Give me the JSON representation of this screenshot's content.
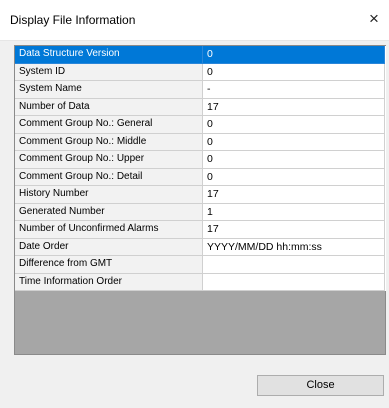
{
  "window": {
    "title": "Display File Information",
    "close_glyph": "×"
  },
  "grid": {
    "rows": [
      {
        "label": "Data Structure Version",
        "value": "0"
      },
      {
        "label": "System ID",
        "value": "0"
      },
      {
        "label": "System Name",
        "value": "-"
      },
      {
        "label": "Number of Data",
        "value": "17"
      },
      {
        "label": "Comment Group No.: General",
        "value": "0"
      },
      {
        "label": "Comment Group No.: Middle",
        "value": "0"
      },
      {
        "label": "Comment Group No.: Upper",
        "value": "0"
      },
      {
        "label": "Comment Group No.: Detail",
        "value": "0"
      },
      {
        "label": "History Number",
        "value": "17"
      },
      {
        "label": "Generated Number",
        "value": "1"
      },
      {
        "label": "Number of Unconfirmed Alarms",
        "value": "17"
      },
      {
        "label": "Date Order",
        "value": "YYYY/MM/DD hh:mm:ss"
      },
      {
        "label": "Difference from GMT",
        "value": ""
      },
      {
        "label": "Time Information Order",
        "value": ""
      }
    ],
    "selected_row": 0
  },
  "footer": {
    "close_label": "Close"
  },
  "colors": {
    "selection": "#0078d7",
    "label_cell": "#f2f2f2",
    "grid_background": "#a6a6a6"
  }
}
